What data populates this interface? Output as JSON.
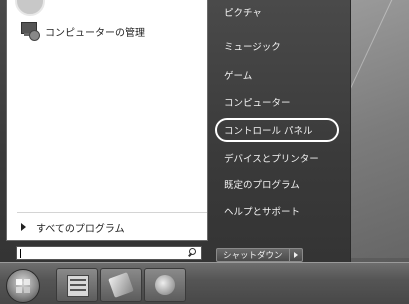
{
  "start_menu": {
    "pinned": [
      {
        "label": "コンピューターの管理",
        "icon": "computer-management-icon"
      }
    ],
    "all_programs_label": "すべてのプログラム",
    "search_placeholder": "",
    "right_items": [
      {
        "label": "ピクチャ",
        "name": "right-item-pictures"
      },
      {
        "label": "ミュージック",
        "name": "right-item-music"
      },
      {
        "label": "ゲーム",
        "name": "right-item-games"
      },
      {
        "label": "コンピューター",
        "name": "right-item-computer"
      },
      {
        "label": "コントロール パネル",
        "name": "right-item-control-panel",
        "highlighted": true
      },
      {
        "label": "デバイスとプリンター",
        "name": "right-item-devices-printers"
      },
      {
        "label": "既定のプログラム",
        "name": "right-item-default-programs"
      },
      {
        "label": "ヘルプとサポート",
        "name": "right-item-help-support"
      }
    ],
    "shutdown_label": "シャットダウン"
  },
  "taskbar": {
    "buttons": [
      {
        "name": "start-button",
        "icon": "windows-orb-icon"
      },
      {
        "name": "taskbar-explorer-button",
        "icon": "explorer-icon"
      },
      {
        "name": "taskbar-media-button",
        "icon": "media-player-icon"
      },
      {
        "name": "taskbar-paint-button",
        "icon": "paint-icon"
      }
    ]
  },
  "colors": {
    "highlight_ring": "#ffffff",
    "menu_right_bg": "#3a3a3a",
    "menu_left_bg": "#ffffff"
  }
}
